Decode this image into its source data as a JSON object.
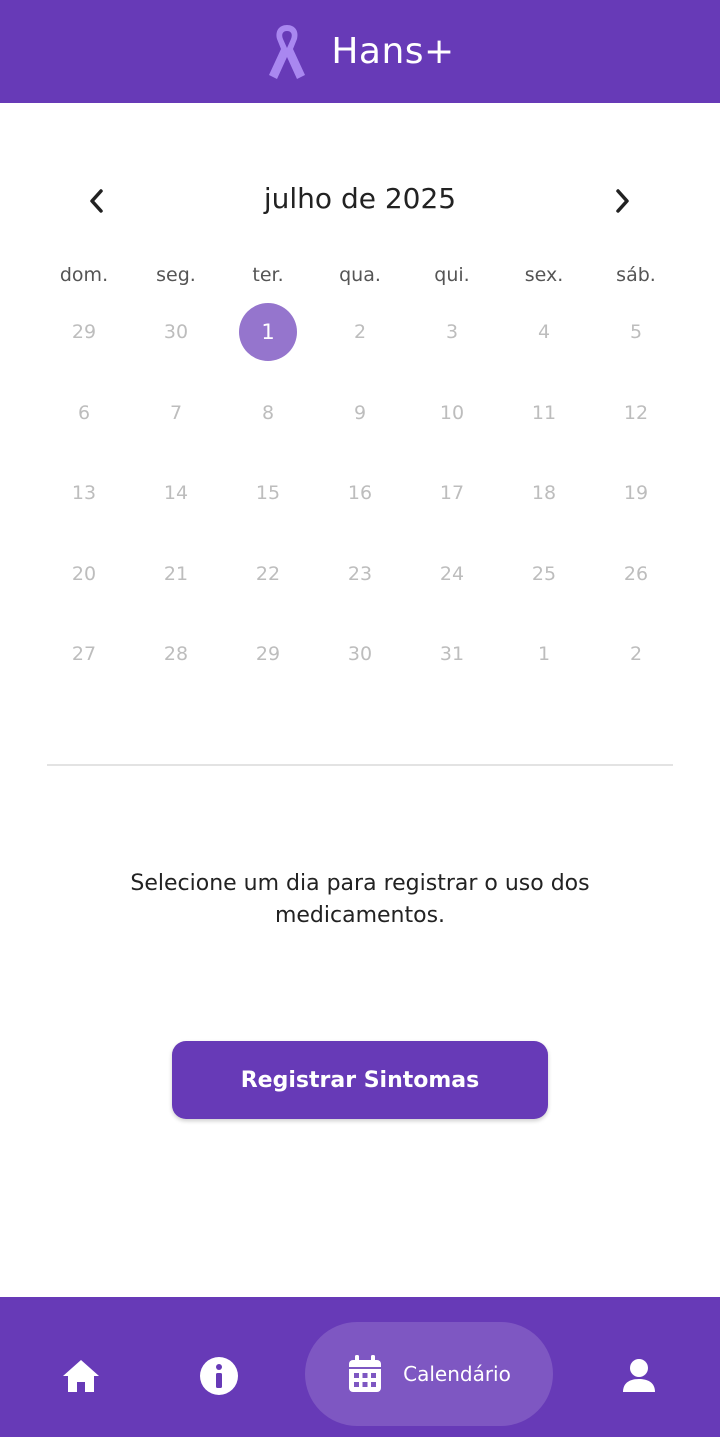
{
  "app_bar": {
    "title": "Hans+",
    "icon": "ribbon-icon",
    "color": "#673ab7"
  },
  "calendar": {
    "month_label": "julho de 2025",
    "weekdays": [
      "dom.",
      "seg.",
      "ter.",
      "qua.",
      "qui.",
      "sex.",
      "sáb."
    ],
    "days": [
      "29",
      "30",
      "1",
      "2",
      "3",
      "4",
      "5",
      "6",
      "7",
      "8",
      "9",
      "10",
      "11",
      "12",
      "13",
      "14",
      "15",
      "16",
      "17",
      "18",
      "19",
      "20",
      "21",
      "22",
      "23",
      "24",
      "25",
      "26",
      "27",
      "28",
      "29",
      "30",
      "31",
      "1",
      "2"
    ],
    "selected_day": "1",
    "selected_color": "#9575cd",
    "prev_icon": "chevron-left-icon",
    "next_icon": "chevron-right-icon"
  },
  "hint_text": "Selecione um dia para registrar o uso dos medicamentos.",
  "primary_button": {
    "label": "Registrar Sintomas"
  },
  "bottom_nav": {
    "items": [
      {
        "icon": "home-icon"
      },
      {
        "icon": "info-icon"
      },
      {
        "icon": "calendar-icon",
        "label": "Calendário",
        "active": true
      },
      {
        "icon": "person-icon"
      }
    ]
  }
}
